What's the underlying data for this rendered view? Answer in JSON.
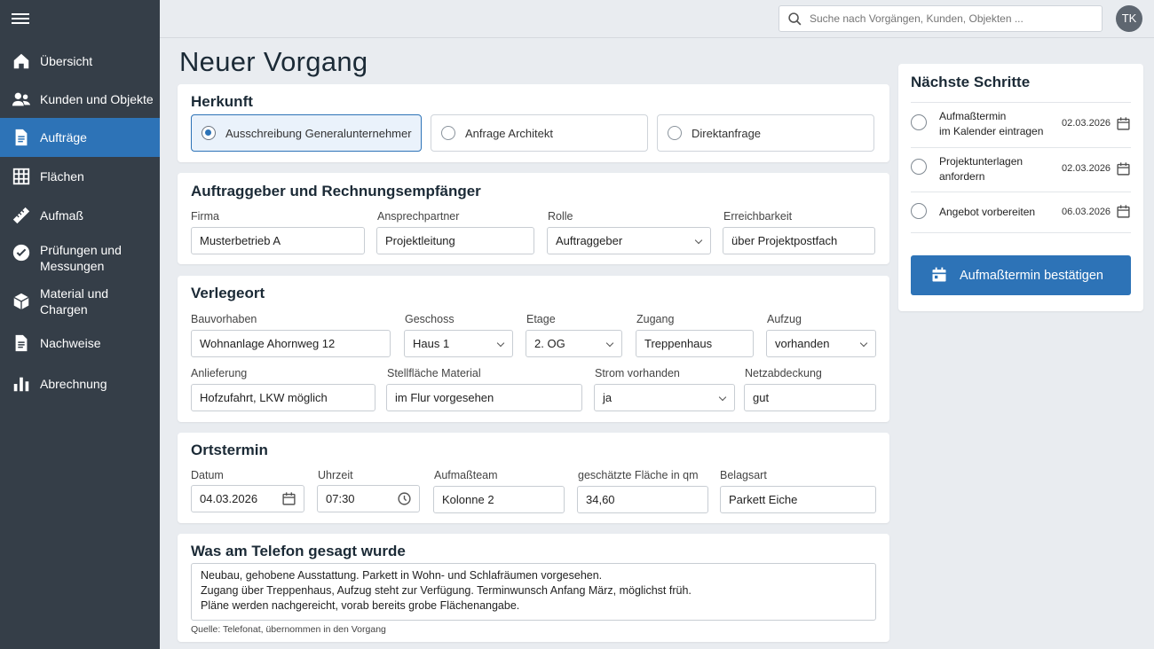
{
  "sidebar": {
    "menu_icon": "hamburger-menu-icon",
    "items": [
      {
        "label": "Übersicht",
        "icon": "home-icon"
      },
      {
        "label": "Kunden und Objekte",
        "icon": "users-icon"
      },
      {
        "label": "Aufträge",
        "icon": "document-icon",
        "active": true
      },
      {
        "label": "Flächen",
        "icon": "grid-icon"
      },
      {
        "label": "Aufmaß",
        "icon": "ruler-icon"
      },
      {
        "label_line1": "Prüfungen und",
        "label_line2": "Messungen",
        "icon": "check-circle-icon"
      },
      {
        "label": "Material und Chargen",
        "icon": "box-icon"
      },
      {
        "label": "Nachweise",
        "icon": "file-icon"
      },
      {
        "label": "Abrechnung",
        "icon": "bar-chart-icon"
      }
    ]
  },
  "topbar": {
    "search_placeholder": "Suche nach Vorgängen, Kunden, Objekten ...",
    "avatar_initials": "TK"
  },
  "page_title": "Neuer Vorgang",
  "herkunft": {
    "title": "Herkunft",
    "options": [
      {
        "label": "Ausschreibung Generalunternehmer",
        "selected": true
      },
      {
        "label": "Anfrage Architekt",
        "selected": false
      },
      {
        "label": "Direktanfrage",
        "selected": false
      }
    ]
  },
  "auftraggeber": {
    "title": "Auftraggeber und Rechnungsempfänger",
    "firma_label": "Firma",
    "firma_value": "Musterbetrieb A",
    "ansprechpartner_label": "Ansprechpartner",
    "ansprechpartner_value": "Projektleitung",
    "rolle_label": "Rolle",
    "rolle_value": "Auftraggeber",
    "erreichbarkeit_label": "Erreichbarkeit",
    "erreichbarkeit_value": "über Projektpostfach"
  },
  "verlegeort": {
    "title": "Verlegeort",
    "bauvorhaben_label": "Bauvorhaben",
    "bauvorhaben_value": "Wohnanlage Ahornweg 12",
    "geschoss_label": "Geschoss",
    "geschoss_value": "Haus 1",
    "etage_label": "Etage",
    "etage_value": "2. OG",
    "zugang_label": "Zugang",
    "zugang_value": "Treppenhaus",
    "aufzug_label": "Aufzug",
    "aufzug_value": "vorhanden",
    "anlieferung_label": "Anlieferung",
    "anlieferung_value": "Hofzufahrt, LKW möglich",
    "stellflaeche_label": "Stellfläche Material",
    "stellflaeche_value": "im Flur vorgesehen",
    "strom_label": "Strom vorhanden",
    "strom_value": "ja",
    "netz_label": "Netzabdeckung",
    "netz_value": "gut"
  },
  "ortstermin": {
    "title": "Ortstermin",
    "datum_label": "Datum",
    "datum_value": "04.03.2026",
    "uhrzeit_label": "Uhrzeit",
    "uhrzeit_value": "07:30",
    "team_label": "Aufmaßteam",
    "team_value": "Kolonne 2",
    "flaeche_label": "geschätzte Fläche in qm",
    "flaeche_value": "34,60",
    "belag_label": "Belagsart",
    "belag_value": "Parkett Eiche"
  },
  "telefon": {
    "title": "Was am Telefon gesagt wurde",
    "line1": "Neubau, gehobene Ausstattung. Parkett in Wohn- und Schlafräumen vorgesehen.",
    "line2": "Zugang über Treppenhaus, Aufzug steht zur Verfügung. Terminwunsch Anfang März, möglichst früh.",
    "line3": "Pläne werden nachgereicht, vorab bereits grobe Flächenangabe.",
    "source": "Quelle: Telefonat, übernommen in den Vorgang"
  },
  "next_steps": {
    "title": "Nächste Schritte",
    "steps": [
      {
        "line1": "Aufmaßtermin",
        "line2": "im Kalender eintragen",
        "date": "02.03.2026"
      },
      {
        "line1": "Projektunterlagen",
        "line2": "anfordern",
        "date": "02.03.2026"
      },
      {
        "line1": "Angebot vorbereiten",
        "date": "06.03.2026"
      }
    ],
    "cta_label": "Aufmaßtermin bestätigen"
  },
  "colors": {
    "sidebar": "#353e48",
    "accent": "#2d73b7",
    "background": "#e9ecf0"
  }
}
